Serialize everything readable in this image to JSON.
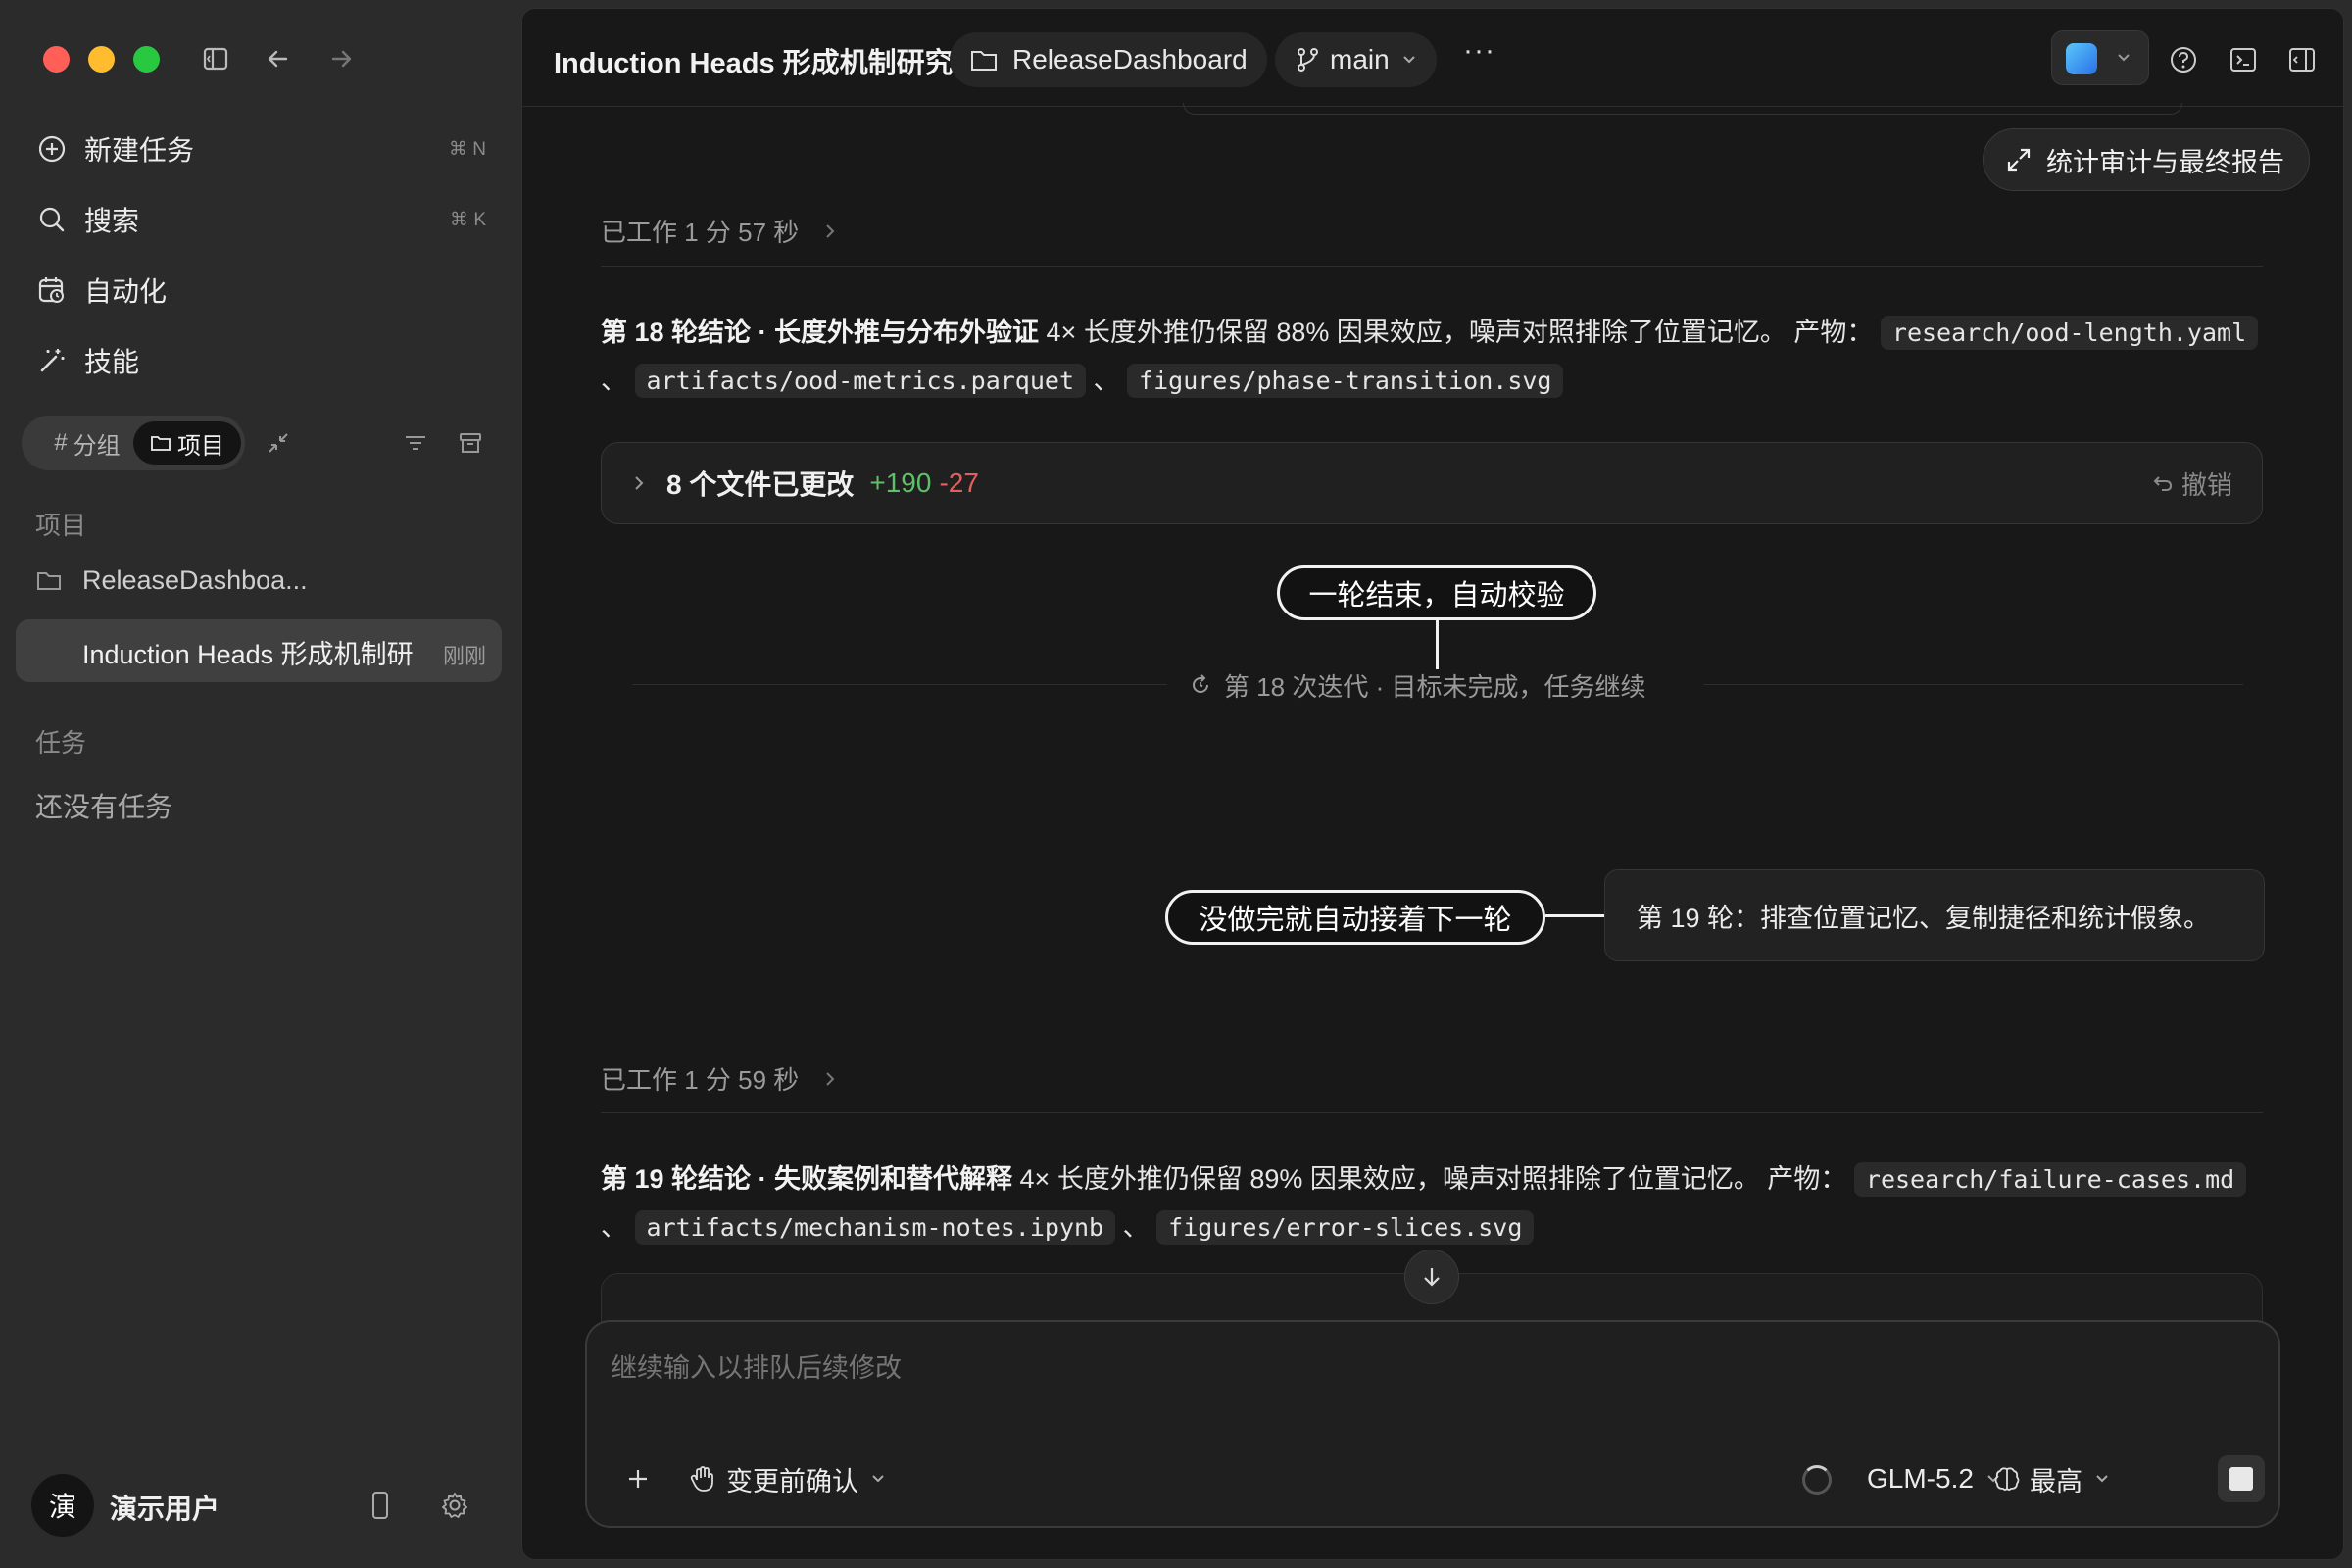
{
  "sidebar": {
    "nav": [
      {
        "label": "新建任务",
        "shortcut": "⌘ N",
        "icon": "plus-circle-icon"
      },
      {
        "label": "搜索",
        "shortcut": "⌘ K",
        "icon": "search-icon"
      },
      {
        "label": "自动化",
        "shortcut": "",
        "icon": "calendar-clock-icon"
      },
      {
        "label": "技能",
        "shortcut": "",
        "icon": "magic-wand-icon"
      }
    ],
    "segments": {
      "group": "分组",
      "project": "项目"
    },
    "projects_label": "项目",
    "projects": [
      {
        "name": "ReleaseDashboa..."
      },
      {
        "name": "Induction Heads 形成机制研",
        "time": "刚刚"
      }
    ],
    "tasks_label": "任务",
    "tasks_empty": "还没有任务",
    "user": {
      "avatar": "演",
      "name": "演示用户"
    }
  },
  "topbar": {
    "title": "Induction Heads 形成机制研究",
    "project_chip": "ReleaseDashboard",
    "branch_chip": "main",
    "more": "···"
  },
  "report_button": "统计审计与最终报告",
  "turns": [
    {
      "worked": "已工作 1 分 57 秒",
      "heading": "第 18 轮结论 · 长度外推与分布外验证",
      "body": " 4× 长度外推仍保留 88% 因果效应，噪声对照排除了位置记忆。 产物：",
      "files": [
        "research/ood-length.yaml",
        "artifacts/ood-metrics.parquet",
        "figures/phase-transition.svg"
      ]
    },
    {
      "worked": "已工作 1 分 59 秒",
      "heading": "第 19 轮结论 · 失败案例和替代解释",
      "body": " 4× 长度外推仍保留 89% 因果效应，噪声对照排除了位置记忆。 产物：",
      "files": [
        "research/failure-cases.md",
        "artifacts/mechanism-notes.ipynb",
        "figures/error-slices.svg"
      ]
    }
  ],
  "changes": {
    "label": "8 个文件已更改",
    "added": "+190",
    "removed": "-27",
    "undo": "撤销"
  },
  "callouts": {
    "round_end": "一轮结束，自动校验",
    "auto_next": "没做完就自动接着下一轮"
  },
  "iteration_status": "第 18 次迭代 · 目标未完成，任务继续",
  "next_round_message": "第 19 轮：排查位置记忆、复制捷径和统计假象。",
  "composer": {
    "placeholder": "继续输入以排队后续修改",
    "approval": "变更前确认",
    "model": "GLM-5.2",
    "effort": "最高"
  },
  "colors": {
    "added": "#5fbf6a",
    "removed": "#e06060",
    "close": "#ff5f57",
    "minimize": "#febc2e",
    "zoom": "#28c840"
  }
}
